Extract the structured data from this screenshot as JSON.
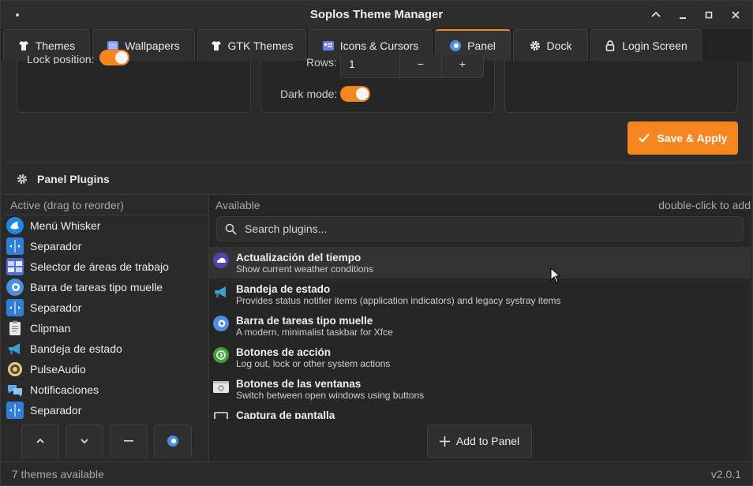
{
  "window": {
    "title": "Soplos Theme Manager"
  },
  "tabs": [
    {
      "label": "Themes",
      "icon": "shirt-icon"
    },
    {
      "label": "Wallpapers",
      "icon": "wallpaper-icon"
    },
    {
      "label": "GTK Themes",
      "icon": "shirt-icon"
    },
    {
      "label": "Icons & Cursors",
      "icon": "icons-icon"
    },
    {
      "label": "Panel",
      "icon": "panel-icon",
      "active": true
    },
    {
      "label": "Dock",
      "icon": "gear-icon"
    },
    {
      "label": "Login Screen",
      "icon": "lock-icon"
    }
  ],
  "panel_settings": {
    "position_label": "Lock position:",
    "rows_label": "Rows:",
    "rows_value": "1",
    "dark_mode_label": "Dark mode:",
    "save_label": "Save & Apply"
  },
  "plugins": {
    "section_title": "Panel Plugins",
    "active_header": "Active (drag to reorder)",
    "available_header": "Available",
    "hint": "double-click to add",
    "search_placeholder": "Search plugins...",
    "active": [
      {
        "label": "Menú Whisker",
        "icon": "whisker-menu-icon"
      },
      {
        "label": "Separador",
        "icon": "separator-icon"
      },
      {
        "label": "Selector de áreas de trabajo",
        "icon": "workspace-switcher-icon"
      },
      {
        "label": "Barra de tareas tipo muelle",
        "icon": "docklike-taskbar-icon"
      },
      {
        "label": "Separador",
        "icon": "separator-icon"
      },
      {
        "label": "Clipman",
        "icon": "clipboard-icon"
      },
      {
        "label": "Bandeja de estado",
        "icon": "megaphone-icon"
      },
      {
        "label": "PulseAudio",
        "icon": "speaker-icon"
      },
      {
        "label": "Notificaciones",
        "icon": "notifications-icon"
      },
      {
        "label": "Separador",
        "icon": "separator-icon"
      }
    ],
    "available": [
      {
        "name": "Actualización del tiempo",
        "desc": "Show current weather conditions",
        "icon": "weather-icon"
      },
      {
        "name": "Bandeja de estado",
        "desc": "Provides status notifier items (application indicators) and legacy systray items",
        "icon": "megaphone-icon"
      },
      {
        "name": "Barra de tareas tipo muelle",
        "desc": "A modern, minimalist taskbar for Xfce",
        "icon": "docklike-taskbar-icon"
      },
      {
        "name": "Botones de acción",
        "desc": "Log out, lock or other system actions",
        "icon": "action-buttons-icon"
      },
      {
        "name": "Botones de las ventanas",
        "desc": "Switch between open windows using buttons",
        "icon": "window-buttons-icon"
      },
      {
        "name": "Captura de pantalla",
        "desc": "",
        "icon": "screenshot-icon"
      }
    ],
    "add_label": "Add to Panel"
  },
  "status": {
    "left": "7 themes available",
    "right": "v2.0.1"
  },
  "colors": {
    "accent": "#f5861f"
  }
}
